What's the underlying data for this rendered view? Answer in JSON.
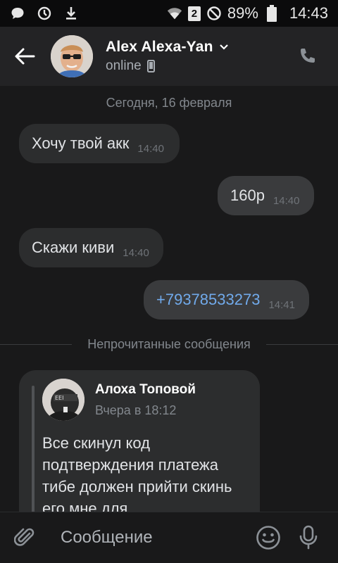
{
  "status_bar": {
    "battery": "89%",
    "time": "14:43",
    "sim_slot": "2",
    "icons": [
      "chat-bubble-icon",
      "sync-icon",
      "download-icon",
      "wifi-icon",
      "sim-icon",
      "do-not-disturb-icon",
      "battery-icon"
    ]
  },
  "header": {
    "contact_name": "Alex Alexa-Yan",
    "status": "online",
    "icons": [
      "back-arrow-icon",
      "chevron-down-icon",
      "phone-device-icon",
      "call-icon"
    ]
  },
  "chat": {
    "date_separator": "Сегодня, 16 февраля",
    "messages": [
      {
        "text": "Хочу твой акк",
        "time": "14:40",
        "direction": "in"
      },
      {
        "text": "160р",
        "time": "14:40",
        "direction": "out"
      },
      {
        "text": "Скажи киви",
        "time": "14:40",
        "direction": "in"
      },
      {
        "text": "+79378533273",
        "time": "14:41",
        "direction": "out",
        "is_link": true
      }
    ],
    "unread_separator": "Непрочитанные сообщения",
    "forwarded": {
      "author": "Алоха Топовой",
      "time": "Вчера в 18:12",
      "text": "Все скинул код подтверждения платежа тибе должен прийти скинь его мне для"
    }
  },
  "composer": {
    "placeholder": "Сообщение",
    "icons": [
      "paperclip-icon",
      "emoji-icon",
      "microphone-icon"
    ]
  },
  "colors": {
    "background": "#19191a",
    "header": "#232325",
    "bubble_in": "#2c2d2e",
    "bubble_out": "#3a3b3d",
    "link": "#71aaeb"
  }
}
